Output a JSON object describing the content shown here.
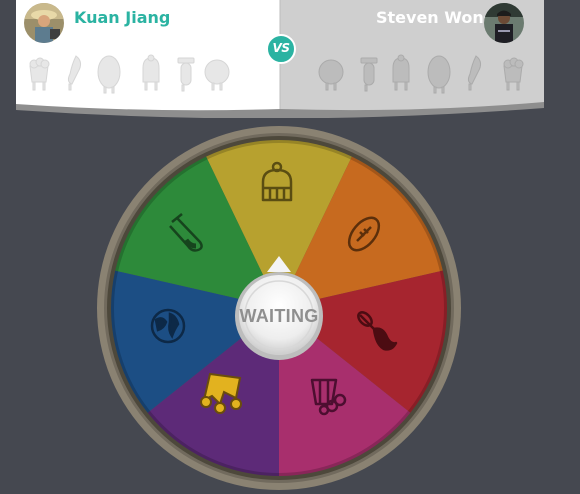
{
  "players": {
    "left": {
      "name": "Kuan Jiang",
      "name_color": "#2bb3a2"
    },
    "right": {
      "name": "Steven Wong",
      "name_color": "#ffffff"
    }
  },
  "versus": {
    "label": "VS",
    "color": "#2bb3a2"
  },
  "trophies": {
    "left": [
      "entertainment-trophy",
      "art-trophy",
      "sports-trophy",
      "history-trophy",
      "science-trophy",
      "geography-trophy"
    ],
    "right": [
      "geography-trophy",
      "science-trophy",
      "history-trophy",
      "sports-trophy",
      "art-trophy",
      "entertainment-trophy"
    ]
  },
  "wheel": {
    "segments": [
      {
        "category": "history",
        "color": "#b7a12f",
        "icon": "history-icon"
      },
      {
        "category": "sports",
        "color": "#c76a1f",
        "icon": "sports-icon"
      },
      {
        "category": "art",
        "color": "#a6252f",
        "icon": "art-icon"
      },
      {
        "category": "entertainment",
        "color": "#a82f6d",
        "icon": "entertainment-icon"
      },
      {
        "category": "crown",
        "color": "#5d2a78",
        "icon": "crown-icon"
      },
      {
        "category": "geography",
        "color": "#1c4e84",
        "icon": "geography-icon"
      },
      {
        "category": "science",
        "color": "#2d8a3a",
        "icon": "science-icon"
      }
    ],
    "rim_color": "#8a8272",
    "spin_button": {
      "label": "WAITING"
    }
  }
}
